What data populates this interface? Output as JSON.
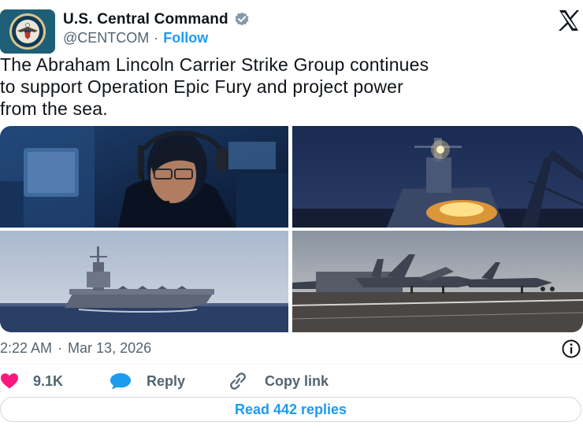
{
  "account": {
    "display_name": "U.S. Central Command",
    "verified_icon": "verified-badge-icon",
    "handle": "@CENTCOM",
    "separator": "·",
    "follow_label": "Follow"
  },
  "platform": {
    "logo_icon": "x-logo-icon"
  },
  "tweet": {
    "text": "The Abraham Lincoln Carrier Strike Group continues\nto support Operation Epic Fury and project power\nfrom the sea.",
    "media": [
      {
        "subject": "sailor-with-headset-photo"
      },
      {
        "subject": "ship-deck-at-night-photo"
      },
      {
        "subject": "aircraft-carrier-at-sea-photo"
      },
      {
        "subject": "fighter-jets-on-deck-photo"
      }
    ],
    "time": "2:22 AM",
    "time_separator": "·",
    "date": "Mar 13, 2026"
  },
  "actions": {
    "like_count": "9.1K",
    "reply_label": "Reply",
    "copy_link_label": "Copy link"
  },
  "footer": {
    "read_replies_label": "Read 442 replies"
  },
  "colors": {
    "accent": "#1d9bf0",
    "like": "#f91880",
    "secondary_text": "#536471",
    "avatar_bg": "#1e5f77"
  }
}
